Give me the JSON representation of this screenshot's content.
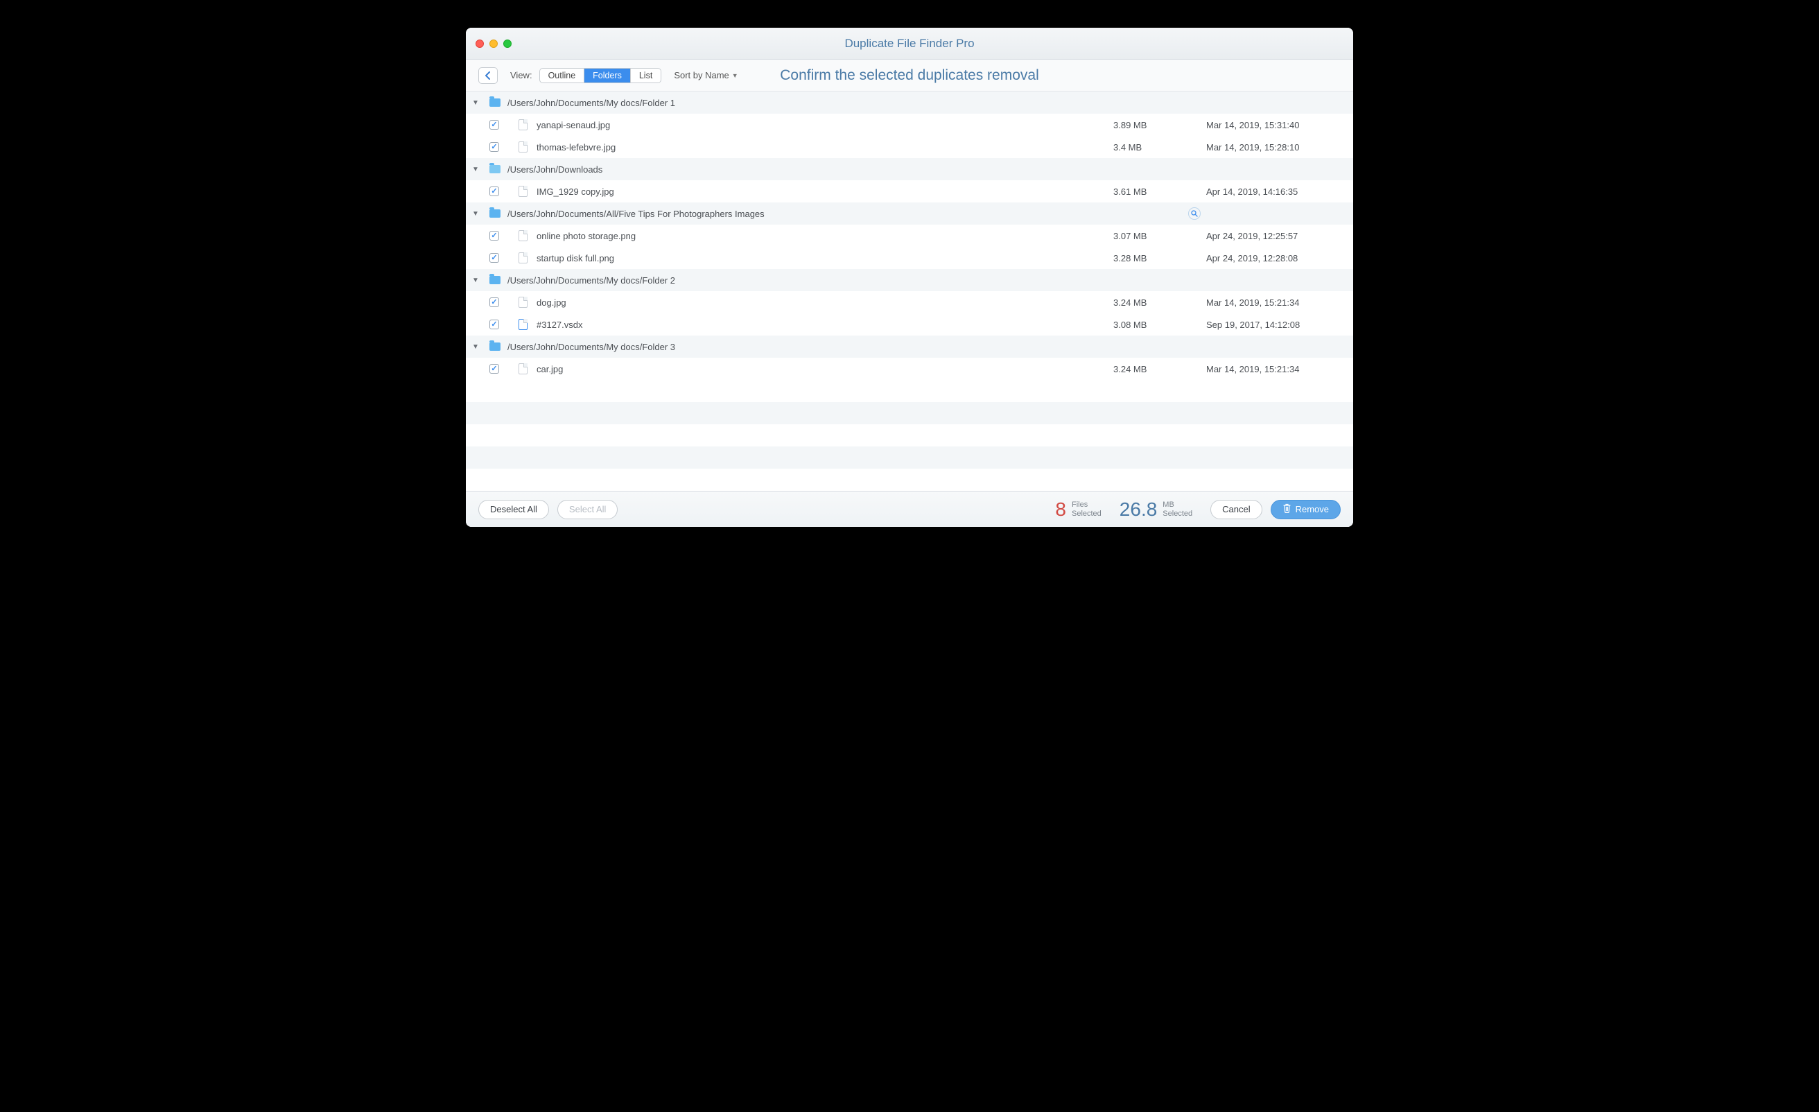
{
  "title": "Duplicate File Finder Pro",
  "toolbar": {
    "view_label": "View:",
    "seg_outline": "Outline",
    "seg_folders": "Folders",
    "seg_list": "List",
    "sort_label": "Sort by Name",
    "heading": "Confirm the selected duplicates removal"
  },
  "groups": [
    {
      "path": "/Users/John/Documents/My docs/Folder 1",
      "icon": "folder",
      "files": [
        {
          "name": "yanapi-senaud.jpg",
          "size": "3.89 MB",
          "date": "Mar 14, 2019, 15:31:40",
          "checked": true,
          "ftype": "img"
        },
        {
          "name": "thomas-lefebvre.jpg",
          "size": "3.4 MB",
          "date": "Mar 14, 2019, 15:28:10",
          "checked": true,
          "ftype": "img"
        }
      ]
    },
    {
      "path": "/Users/John/Downloads",
      "icon": "downloads",
      "files": [
        {
          "name": "IMG_1929 copy.jpg",
          "size": "3.61 MB",
          "date": "Apr 14, 2019, 14:16:35",
          "checked": true,
          "ftype": "img"
        }
      ]
    },
    {
      "path": "/Users/John/Documents/All/Five Tips For Photographers Images",
      "icon": "folder",
      "magnifier": true,
      "files": [
        {
          "name": "online photo storage.png",
          "size": "3.07 MB",
          "date": "Apr 24, 2019, 12:25:57",
          "checked": true,
          "ftype": "img"
        },
        {
          "name": "startup disk full.png",
          "size": "3.28 MB",
          "date": "Apr 24, 2019, 12:28:08",
          "checked": true,
          "ftype": "img"
        }
      ]
    },
    {
      "path": "/Users/John/Documents/My docs/Folder 2",
      "icon": "folder",
      "files": [
        {
          "name": "dog.jpg",
          "size": "3.24 MB",
          "date": "Mar 14, 2019, 15:21:34",
          "checked": true,
          "ftype": "img"
        },
        {
          "name": "#3127.vsdx",
          "size": "3.08 MB",
          "date": "Sep 19, 2017, 14:12:08",
          "checked": true,
          "ftype": "doc"
        }
      ]
    },
    {
      "path": "/Users/John/Documents/My docs/Folder 3",
      "icon": "folder",
      "files": [
        {
          "name": "car.jpg",
          "size": "3.24 MB",
          "date": "Mar 14, 2019, 15:21:34",
          "checked": true,
          "ftype": "img"
        }
      ]
    }
  ],
  "footer": {
    "deselect_all": "Deselect All",
    "select_all": "Select All",
    "files_count": "8",
    "files_unit": "Files",
    "files_word": "Selected",
    "size_value": "26.8",
    "size_unit": "MB",
    "size_word": "Selected",
    "cancel": "Cancel",
    "remove": "Remove"
  }
}
